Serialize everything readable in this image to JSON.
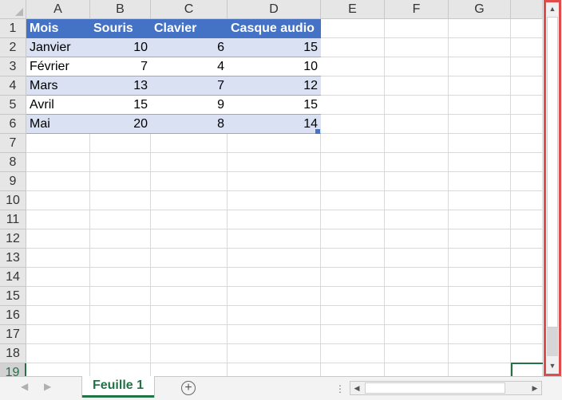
{
  "columns": [
    "A",
    "B",
    "C",
    "D",
    "E",
    "F",
    "G",
    ""
  ],
  "rows": [
    "1",
    "2",
    "3",
    "4",
    "5",
    "6",
    "7",
    "8",
    "9",
    "10",
    "11",
    "12",
    "13",
    "14",
    "15",
    "16",
    "17",
    "18",
    "19"
  ],
  "table": {
    "headers": [
      "Mois",
      "Souris",
      "Clavier",
      "Casque audio"
    ],
    "data": [
      [
        "Janvier",
        "10",
        "6",
        "15"
      ],
      [
        "Février",
        "7",
        "4",
        "10"
      ],
      [
        "Mars",
        "13",
        "7",
        "12"
      ],
      [
        "Avril",
        "15",
        "9",
        "15"
      ],
      [
        "Mai",
        "20",
        "8",
        "14"
      ]
    ]
  },
  "sheet_tab": {
    "label": "Feuille 1"
  },
  "add_sheet": {
    "label": "+"
  },
  "nav": {
    "prev": "◀",
    "next": "▶",
    "dots": "⋮"
  },
  "scroll": {
    "up": "▲",
    "down": "▼",
    "left": "◀",
    "right": "▶"
  },
  "colors": {
    "table_header": "#4472c4",
    "table_band": "#d9e1f2",
    "accent": "#217346",
    "highlight_border": "#e04b4b"
  }
}
